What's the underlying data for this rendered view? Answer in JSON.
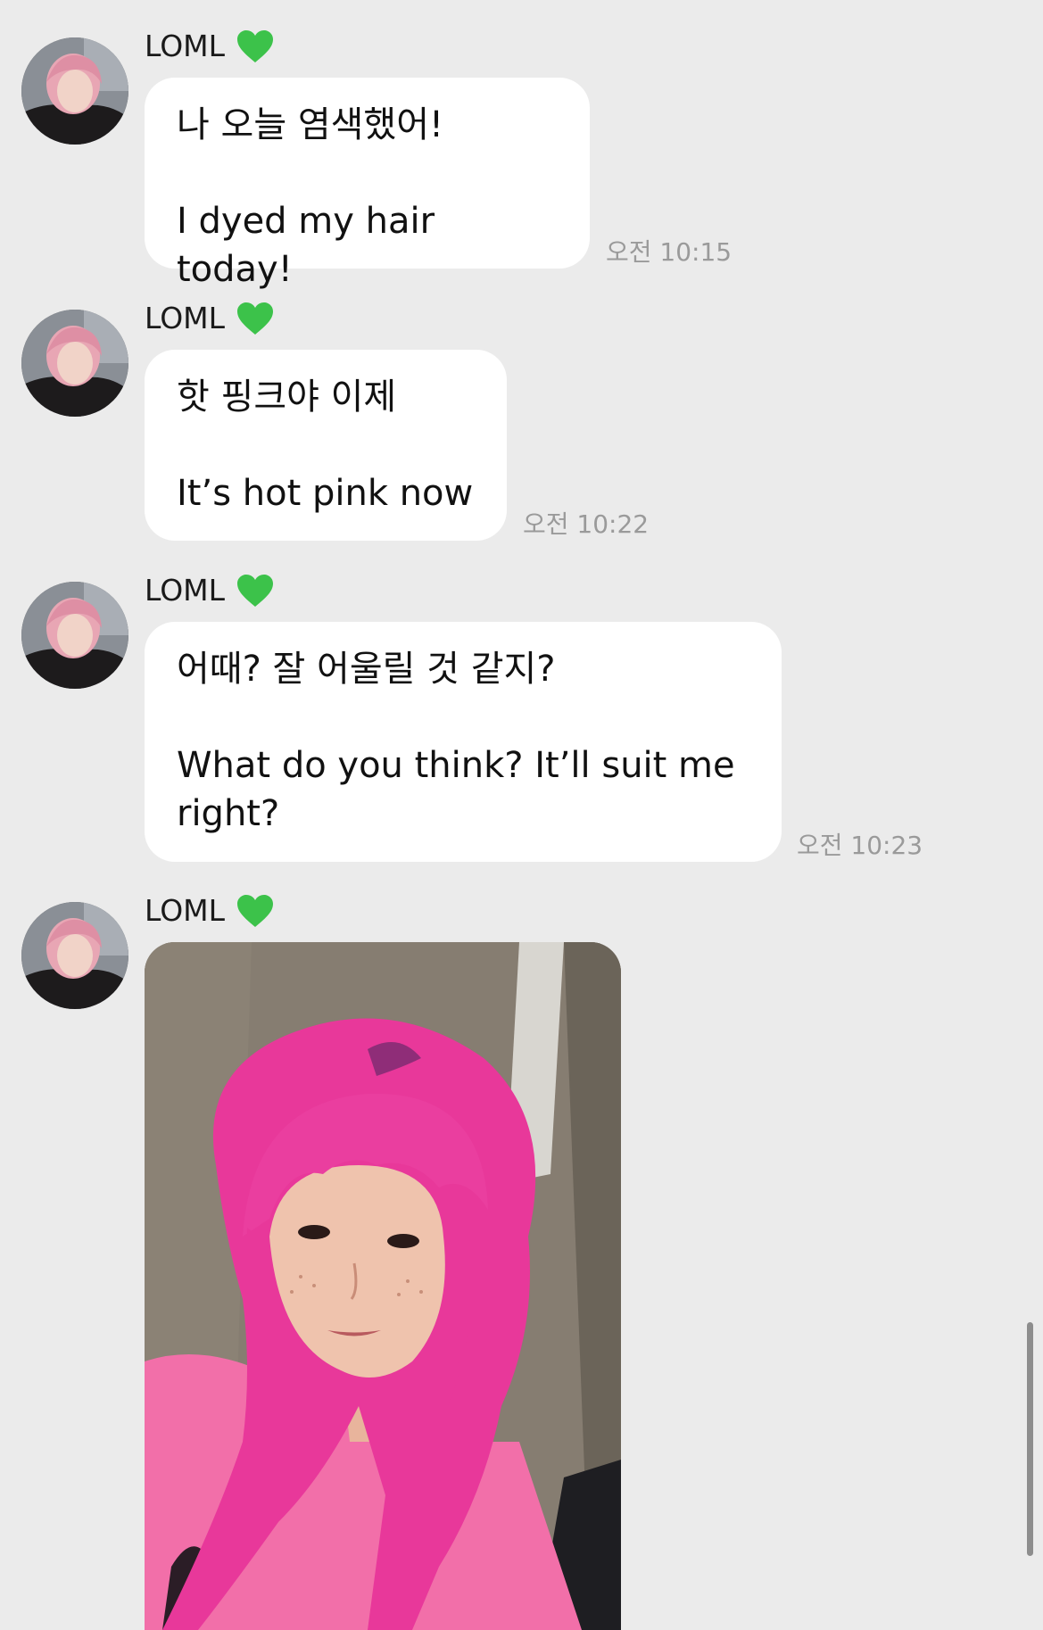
{
  "messages": [
    {
      "sender": "LOML",
      "korean": "나 오늘 염색했어!",
      "english": "I dyed my hair today!",
      "time": "오전 10:15"
    },
    {
      "sender": "LOML",
      "korean": "핫 핑크야 이제",
      "english": "It’s hot pink now",
      "time": "오전 10:22"
    },
    {
      "sender": "LOML",
      "korean": "어때? 잘 어울릴 것 같지?",
      "english": "What do you think? It’ll suit me right?",
      "time": "오전 10:23"
    },
    {
      "sender": "LOML",
      "type": "photo"
    }
  ],
  "colors": {
    "background": "#ebebeb",
    "bubble": "#ffffff",
    "heart": "#3cc24a",
    "hair": "#e8389a"
  },
  "icons": {
    "heart": "green-heart-icon"
  }
}
